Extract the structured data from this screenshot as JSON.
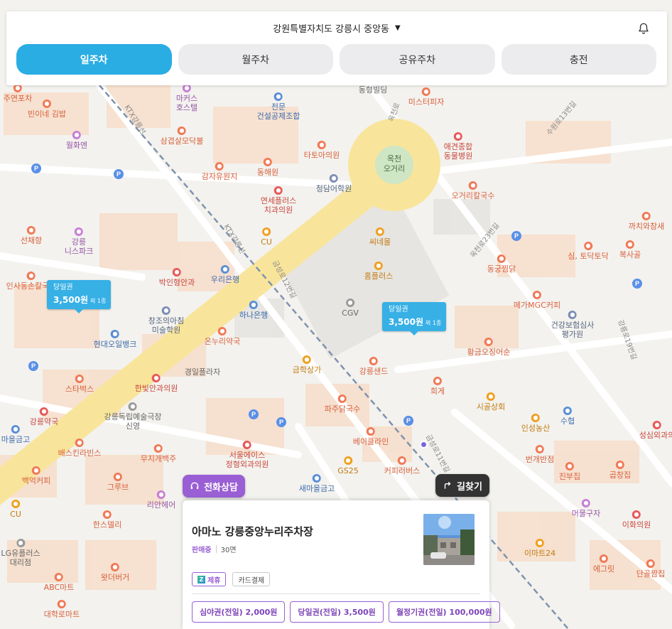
{
  "location": {
    "region": "강원특별자치도 강릉시 중앙동"
  },
  "tabs": [
    {
      "label": "일주차",
      "active": true
    },
    {
      "label": "월주차",
      "active": false
    },
    {
      "label": "공유주차",
      "active": false
    },
    {
      "label": "충전",
      "active": false
    }
  ],
  "markers": [
    {
      "type": "당일권",
      "price": "3,500원",
      "unit": "외 1종"
    },
    {
      "type": "당일권",
      "price": "3,500원",
      "unit": "외 1종"
    }
  ],
  "buttons": {
    "consult": "전화상담",
    "route": "길찾기"
  },
  "card": {
    "title": "아마노 강릉중앙누리주차장",
    "status": "판매중",
    "spaces": "30면",
    "tags": [
      "제휴",
      "카드결제"
    ],
    "tickets": [
      "심야권(전일) 2,000원",
      "당일권(전일) 3,500원",
      "월정기권(전일) 100,000원"
    ]
  },
  "map_labels": {
    "plaza": "옥천\n오거리",
    "pois": [
      "주연포차",
      "빈이네 김밥",
      "월화엔",
      "마커스\n호스텔",
      "삼겹살모닥불",
      "감자유원지",
      "전문\n건설공제조합",
      "동형빌딩",
      "미스터피자",
      "애견종합\n동물병원",
      "타토아의원",
      "동해원",
      "연세플러스\n치과의원",
      "청담어학원",
      "오거리칼국수",
      "까치와참새",
      "복사골",
      "심, 토닥토닥",
      "동궁찜닭",
      "메가MGC커피",
      "건강보험심사\n평가원",
      "선채향",
      "강릉\n니스파크",
      "CU",
      "씨네몰",
      "홈플러스",
      "CGV",
      "박인형안과",
      "우리은행",
      "하나은행",
      "창조의아침\n미술학원",
      "현대오일뱅크",
      "온누리약국",
      "경일플라자",
      "금학상가",
      "강릉샌드",
      "희게",
      "황금오징어순",
      "시골상회",
      "인성농산",
      "수협",
      "성심외과의",
      "스타벅스",
      "한빛안과의원",
      "강릉독립예술극장\n신영",
      "파주닭국수",
      "베이클라인",
      "번개반점",
      "진부집",
      "곱창집",
      "서울에이스\n정형외과의원",
      "GS25",
      "커피러버스",
      "무지개백주",
      "강릉약국",
      "배스킨라빈스",
      "백억커피",
      "그루브",
      "리안헤어",
      "한스델리",
      "새마을금고",
      "머물구자",
      "이화의원",
      "이마트24",
      "에그릿",
      "단골짬집",
      "LG유플러스\n대리점",
      "ABC마트",
      "왓더버거",
      "대학로마트",
      "마을금고",
      "인사동손칼국시"
    ],
    "streets": [
      "KTX강릉선",
      "금성로12번길",
      "옥천로23번길",
      "수원로13번길",
      "금성로11번길",
      "금성로",
      "옥천로",
      "강릉로19번길"
    ]
  }
}
